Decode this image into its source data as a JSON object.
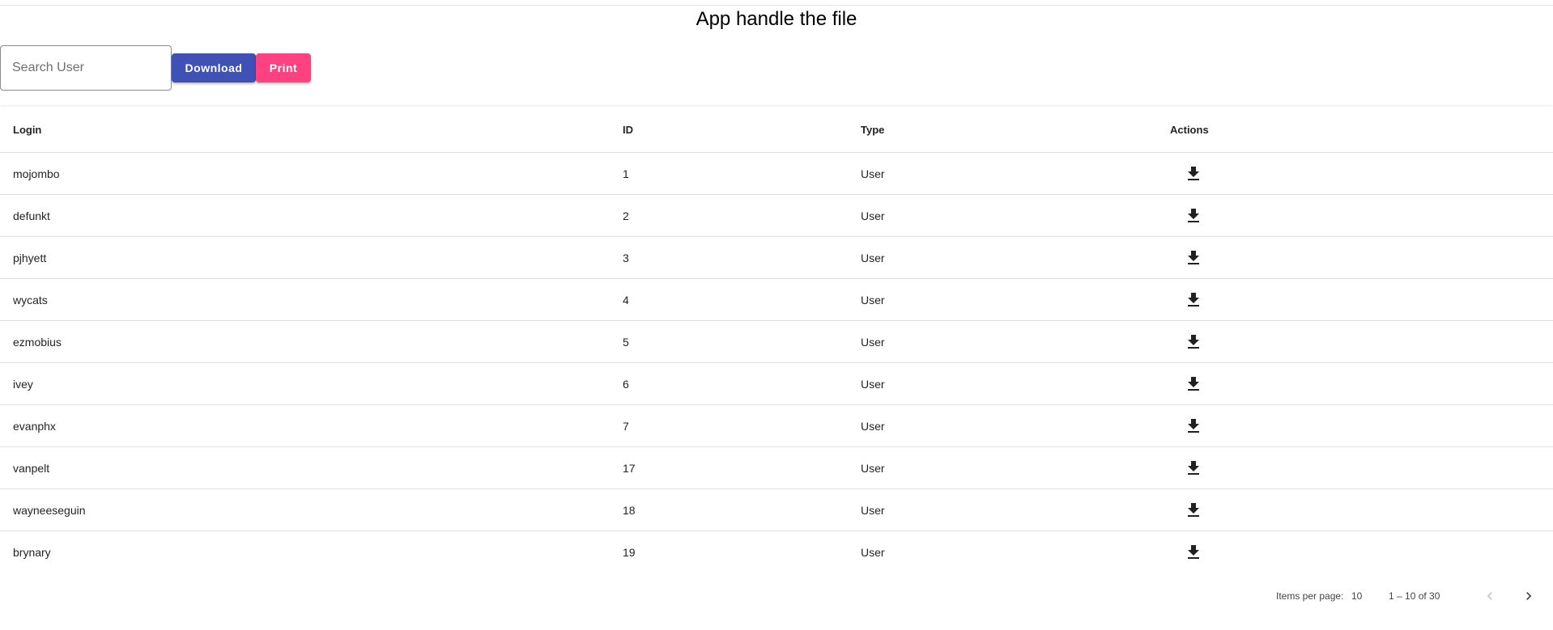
{
  "header": {
    "title": "App handle the file"
  },
  "toolbar": {
    "search_placeholder": "Search User",
    "search_value": "",
    "download_label": "Download",
    "print_label": "Print"
  },
  "colors": {
    "download_button": "#3f51b5",
    "print_button": "#ff4081"
  },
  "table": {
    "columns": [
      "Login",
      "ID",
      "Type",
      "Actions"
    ],
    "action_icon": "download-icon",
    "rows": [
      {
        "login": "mojombo",
        "id": "1",
        "type": "User"
      },
      {
        "login": "defunkt",
        "id": "2",
        "type": "User"
      },
      {
        "login": "pjhyett",
        "id": "3",
        "type": "User"
      },
      {
        "login": "wycats",
        "id": "4",
        "type": "User"
      },
      {
        "login": "ezmobius",
        "id": "5",
        "type": "User"
      },
      {
        "login": "ivey",
        "id": "6",
        "type": "User"
      },
      {
        "login": "evanphx",
        "id": "7",
        "type": "User"
      },
      {
        "login": "vanpelt",
        "id": "17",
        "type": "User"
      },
      {
        "login": "wayneeseguin",
        "id": "18",
        "type": "User"
      },
      {
        "login": "brynary",
        "id": "19",
        "type": "User"
      }
    ]
  },
  "paginator": {
    "items_per_page_label": "Items per page:",
    "page_size": "10",
    "range_label": "1 – 10 of 30",
    "prev_icon": "chevron-left-icon",
    "next_icon": "chevron-right-icon"
  }
}
